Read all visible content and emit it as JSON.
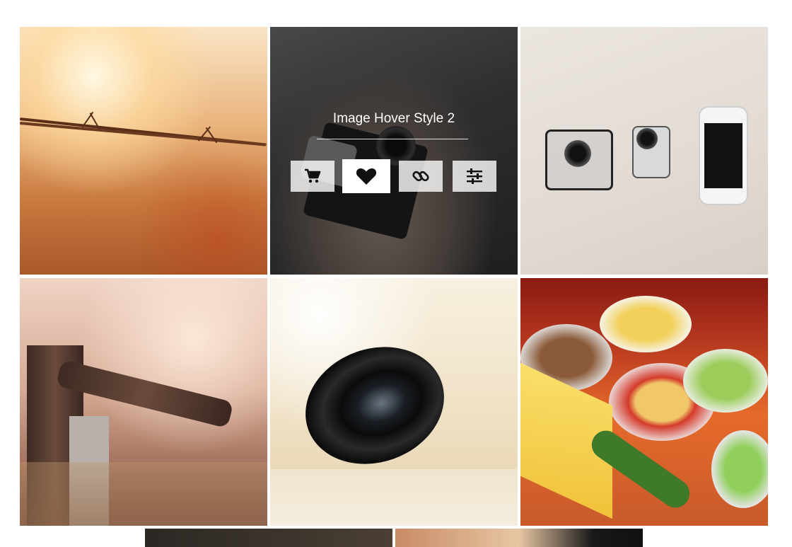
{
  "gallery": {
    "hover_item": {
      "title": "Image Hover Style 2",
      "actions": [
        {
          "icon": "cart-icon",
          "active": false
        },
        {
          "icon": "heart-icon",
          "active": true
        },
        {
          "icon": "link-icon",
          "active": false
        },
        {
          "icon": "sliders-icon",
          "active": false
        }
      ]
    },
    "images": [
      {
        "subject": "barbed-wire"
      },
      {
        "subject": "camera-in-hand"
      },
      {
        "subject": "action-cameras-and-phone"
      },
      {
        "subject": "fence-post"
      },
      {
        "subject": "camera-lens"
      },
      {
        "subject": "food-spread"
      },
      {
        "subject": "dark-landscape"
      },
      {
        "subject": "warm-interior"
      }
    ]
  }
}
